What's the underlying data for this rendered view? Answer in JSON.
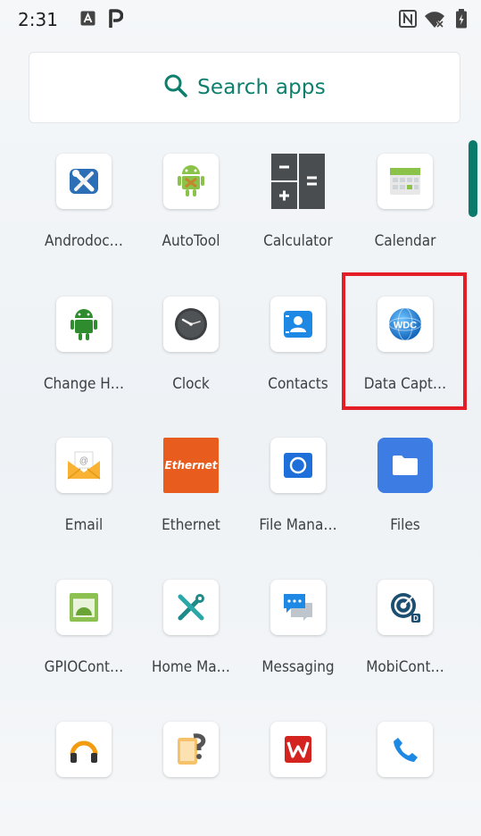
{
  "status_bar": {
    "time": "2:31",
    "left_icons": [
      "keyboard-a-icon",
      "parking-p-icon"
    ],
    "right_icons": [
      "nfc-icon",
      "wifi-off-icon",
      "battery-charging-icon"
    ]
  },
  "search": {
    "label": "Search apps",
    "icon": "search-icon",
    "accent_color": "#0e7f6d"
  },
  "apps": [
    {
      "label": "Androdoc…",
      "icon": "androdoc-icon"
    },
    {
      "label": "AutoTool",
      "icon": "autotool-icon"
    },
    {
      "label": "Calculator",
      "icon": "calculator-icon"
    },
    {
      "label": "Calendar",
      "icon": "calendar-icon"
    },
    {
      "label": "Change H…",
      "icon": "change-home-icon"
    },
    {
      "label": "Clock",
      "icon": "clock-icon"
    },
    {
      "label": "Contacts",
      "icon": "contacts-icon"
    },
    {
      "label": "Data Capt…",
      "icon": "data-capture-icon"
    },
    {
      "label": "Email",
      "icon": "email-icon"
    },
    {
      "label": "Ethernet",
      "icon": "ethernet-icon",
      "icon_text": "Ethernet"
    },
    {
      "label": "File Mana…",
      "icon": "file-manager-icon"
    },
    {
      "label": "Files",
      "icon": "files-icon"
    },
    {
      "label": "GPIOCont…",
      "icon": "gpio-control-icon"
    },
    {
      "label": "Home Ma…",
      "icon": "home-manager-icon"
    },
    {
      "label": "Messaging",
      "icon": "messaging-icon"
    },
    {
      "label": "MobiCont…",
      "icon": "mobicontrol-icon"
    },
    {
      "label": "",
      "icon": "headphones-icon"
    },
    {
      "label": "",
      "icon": "nfc-tag-icon"
    },
    {
      "label": "",
      "icon": "wps-icon"
    },
    {
      "label": "",
      "icon": "phone-icon"
    }
  ],
  "data_capture_icon_text": "WDC",
  "highlight": {
    "target": "Data Capt…",
    "color": "#e41e26"
  }
}
